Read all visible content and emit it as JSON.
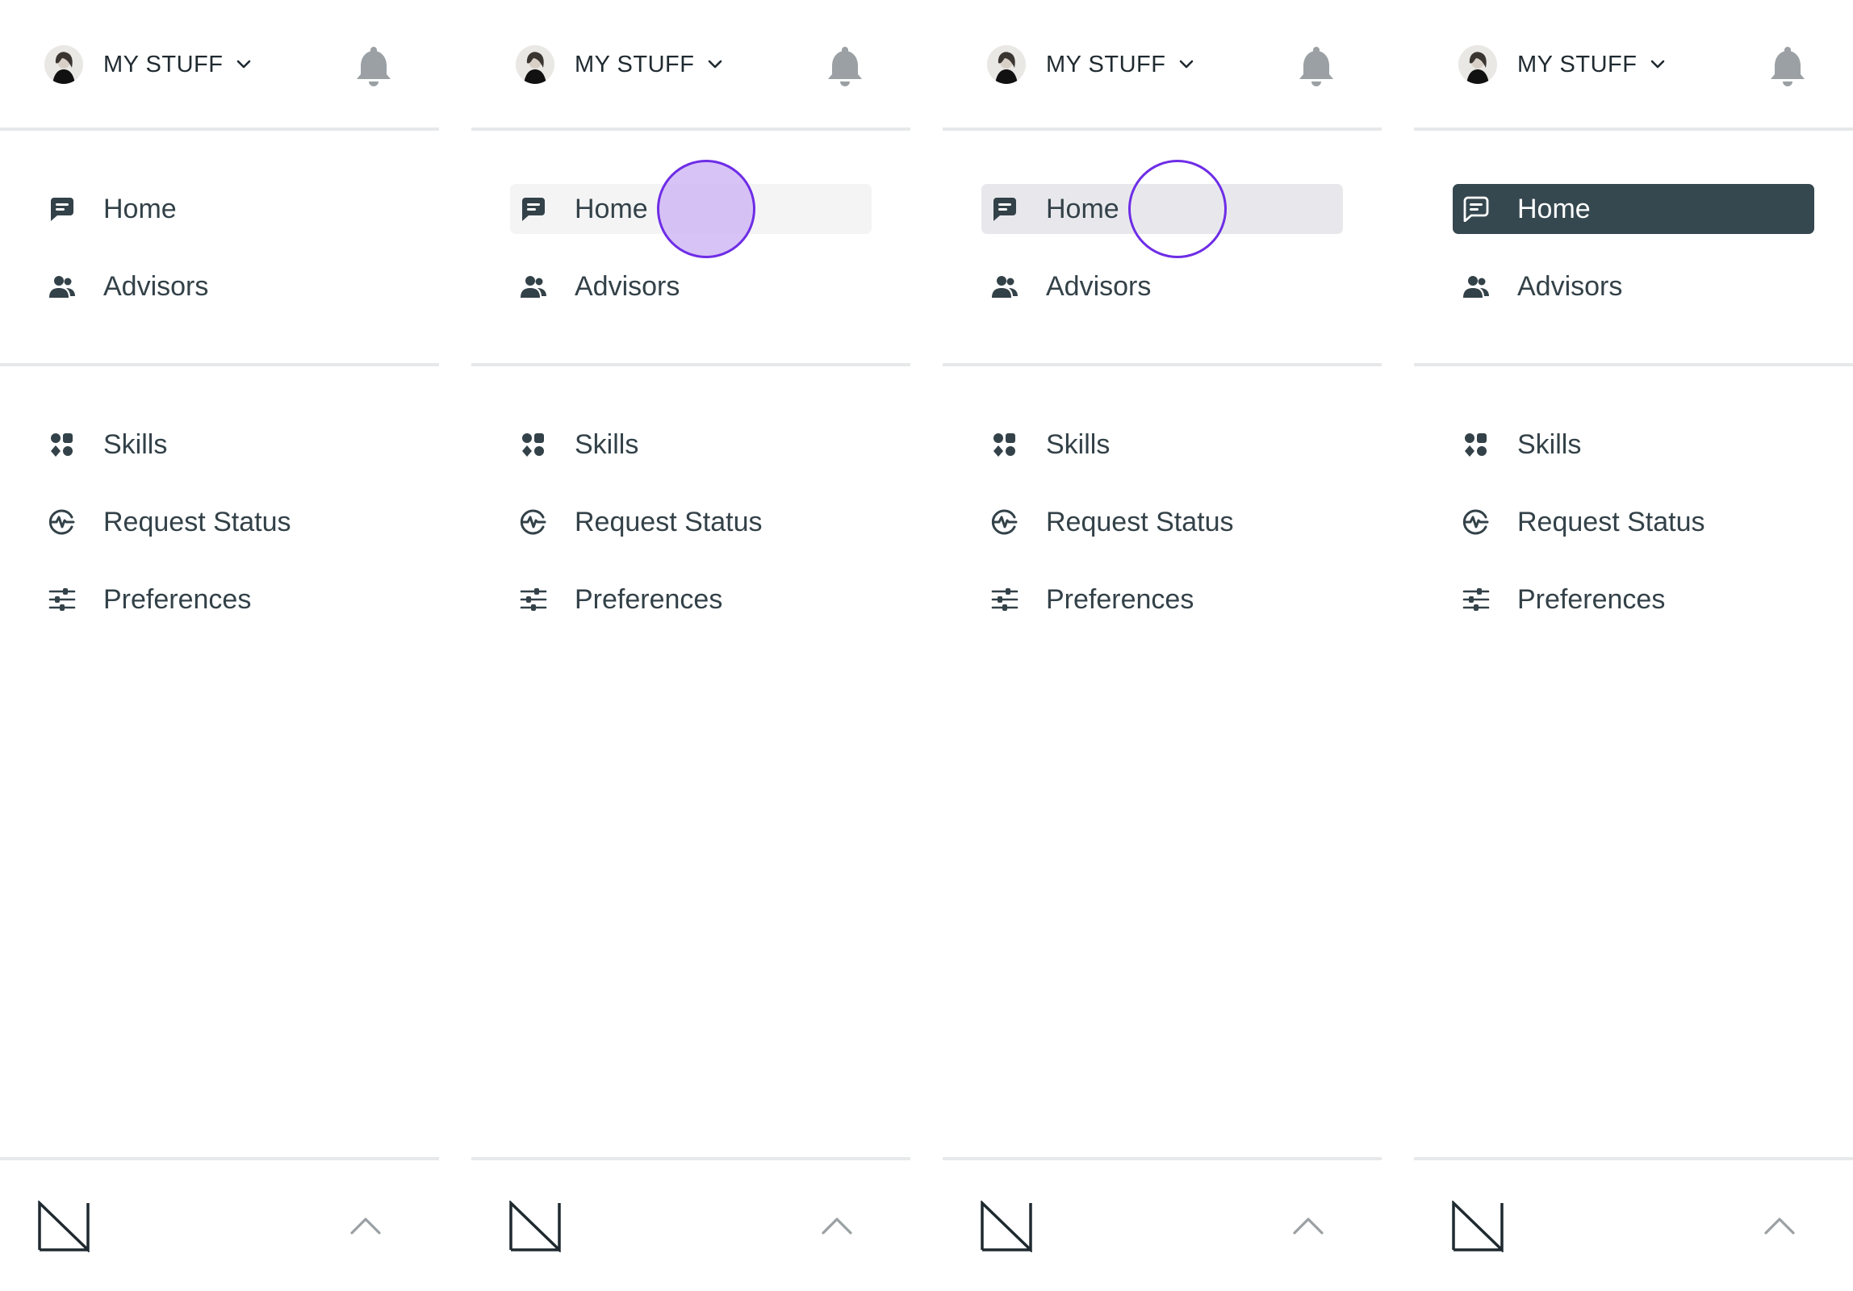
{
  "panels": [
    {
      "state": "default",
      "header": {
        "title": "MY STUFF"
      },
      "nav_primary": [
        {
          "label": "Home",
          "icon": "chat-icon"
        },
        {
          "label": "Advisors",
          "icon": "people-icon"
        }
      ],
      "nav_secondary": [
        {
          "label": "Skills",
          "icon": "skills-icon"
        },
        {
          "label": "Request Status",
          "icon": "activity-icon"
        },
        {
          "label": "Preferences",
          "icon": "sliders-icon"
        }
      ]
    },
    {
      "state": "hover",
      "header": {
        "title": "MY STUFF"
      },
      "nav_primary": [
        {
          "label": "Home",
          "icon": "chat-icon"
        },
        {
          "label": "Advisors",
          "icon": "people-icon"
        }
      ],
      "nav_secondary": [
        {
          "label": "Skills",
          "icon": "skills-icon"
        },
        {
          "label": "Request Status",
          "icon": "activity-icon"
        },
        {
          "label": "Preferences",
          "icon": "sliders-icon"
        }
      ]
    },
    {
      "state": "pressed",
      "header": {
        "title": "MY STUFF"
      },
      "nav_primary": [
        {
          "label": "Home",
          "icon": "chat-icon"
        },
        {
          "label": "Advisors",
          "icon": "people-icon"
        }
      ],
      "nav_secondary": [
        {
          "label": "Skills",
          "icon": "skills-icon"
        },
        {
          "label": "Request Status",
          "icon": "activity-icon"
        },
        {
          "label": "Preferences",
          "icon": "sliders-icon"
        }
      ]
    },
    {
      "state": "active",
      "header": {
        "title": "MY STUFF"
      },
      "nav_primary": [
        {
          "label": "Home",
          "icon": "chat-icon"
        },
        {
          "label": "Advisors",
          "icon": "people-icon"
        }
      ],
      "nav_secondary": [
        {
          "label": "Skills",
          "icon": "skills-icon"
        },
        {
          "label": "Request Status",
          "icon": "activity-icon"
        },
        {
          "label": "Preferences",
          "icon": "sliders-icon"
        }
      ]
    }
  ],
  "colors": {
    "text": "#334148",
    "active_bg": "#35474f",
    "hover_bg": "#f4f4f5",
    "pressed_bg": "#e8e8ec",
    "divider": "#e7e8ea",
    "touch_ring": "#6e2de6",
    "bell": "#9aa0a3"
  }
}
